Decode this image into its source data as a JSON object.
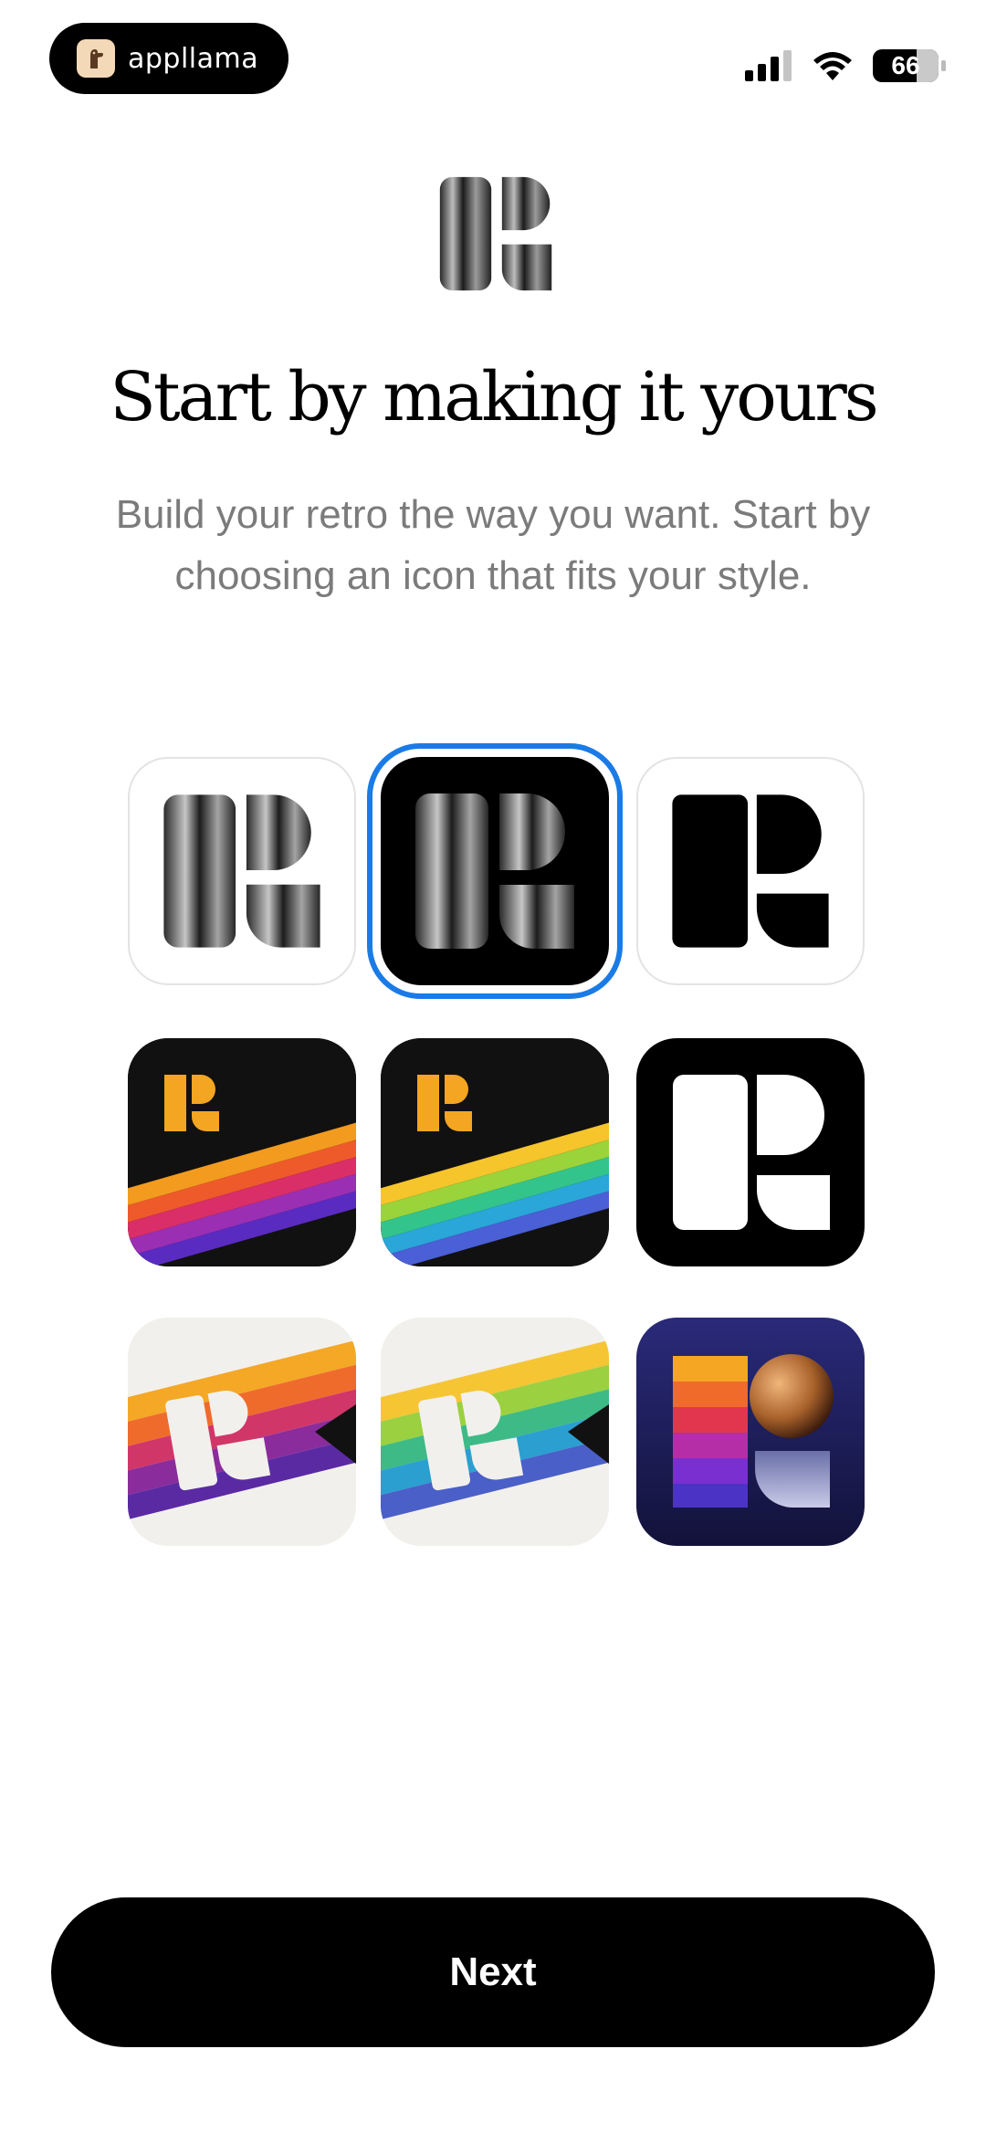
{
  "status_bar": {
    "app_badge": "appllama",
    "battery": "66",
    "icons": [
      "signal-icon",
      "wifi-icon",
      "battery-icon"
    ]
  },
  "header": {
    "title": "Start by making it yours",
    "subtitle": "Build your retro the way you want. Start by choosing an icon that fits your style."
  },
  "icon_options": [
    {
      "style": "chrome-on-white",
      "selected": false
    },
    {
      "style": "chrome-on-black",
      "selected": true
    },
    {
      "style": "black-on-white",
      "selected": false
    },
    {
      "style": "retro-stripes-purple",
      "selected": false
    },
    {
      "style": "retro-stripes-rainbow",
      "selected": false
    },
    {
      "style": "white-on-black",
      "selected": false
    },
    {
      "style": "paper-stripes-purple",
      "selected": false
    },
    {
      "style": "paper-stripes-rainbow",
      "selected": false
    },
    {
      "style": "gradient-navy",
      "selected": false
    }
  ],
  "colors": {
    "accent": "#1a7be6",
    "button": "#000000",
    "subtitle": "#7b7b7b"
  },
  "footer": {
    "next_label": "Next"
  }
}
